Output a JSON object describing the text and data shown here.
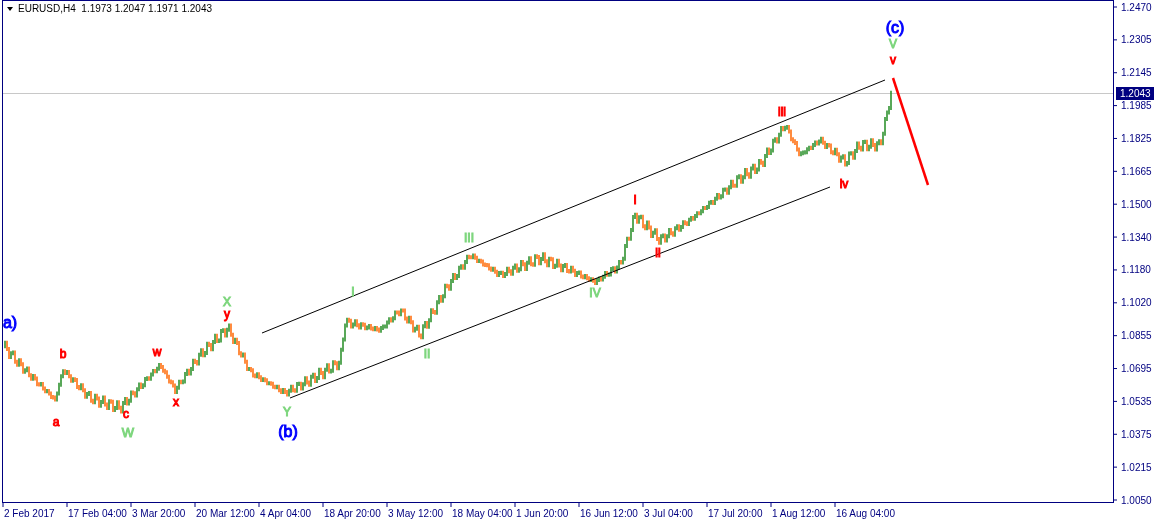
{
  "header": {
    "symbol": "EURUSD,H4",
    "open": "1.1973",
    "high": "1.2047",
    "low": "1.1971",
    "close": "1.2043"
  },
  "chart": {
    "price_tag": "1.2043",
    "y_axis_labels": [
      "1.2470",
      "1.2305",
      "1.2145",
      "1.1985",
      "1.1825",
      "1.1665",
      "1.1500",
      "1.1340",
      "1.1180",
      "1.1020",
      "1.0855",
      "1.0695",
      "1.0535",
      "1.0375",
      "1.0215",
      "1.0050"
    ],
    "x_axis_labels": [
      "2 Feb 2017",
      "17 Feb 04:00",
      "3 Mar 20:00",
      "20 Mar 12:00",
      "4 Apr 04:00",
      "18 Apr 20:00",
      "3 May 12:00",
      "18 May 04:00",
      "1 Jun 20:00",
      "16 Jun 12:00",
      "3 Jul 04:00",
      "17 Jul 20:00",
      "1 Aug 12:00",
      "16 Aug 04:00"
    ],
    "wave_labels": [
      {
        "text": "a)",
        "color": "#0000ff"
      },
      {
        "text": "b",
        "color": "#ff0000"
      },
      {
        "text": "a",
        "color": "#ff0000"
      },
      {
        "text": "c",
        "color": "#ff0000"
      },
      {
        "text": "W",
        "color": "#7ed67e"
      },
      {
        "text": "w",
        "color": "#ff0000"
      },
      {
        "text": "x",
        "color": "#ff0000"
      },
      {
        "text": "X",
        "color": "#7ed67e"
      },
      {
        "text": "y",
        "color": "#ff0000"
      },
      {
        "text": "Y",
        "color": "#7ed67e"
      },
      {
        "text": "(b)",
        "color": "#0000ff"
      },
      {
        "text": "I",
        "color": "#7ed67e"
      },
      {
        "text": "II",
        "color": "#7ed67e"
      },
      {
        "text": "III",
        "color": "#7ed67e"
      },
      {
        "text": "IV",
        "color": "#7ed67e"
      },
      {
        "text": "i",
        "color": "#ff0000"
      },
      {
        "text": "ii",
        "color": "#ff0000"
      },
      {
        "text": "iii",
        "color": "#ff0000"
      },
      {
        "text": "iv",
        "color": "#ff0000"
      },
      {
        "text": "(c)",
        "color": "#0000ff"
      },
      {
        "text": "V",
        "color": "#7ed67e"
      },
      {
        "text": "v",
        "color": "#ff0000"
      }
    ]
  }
}
